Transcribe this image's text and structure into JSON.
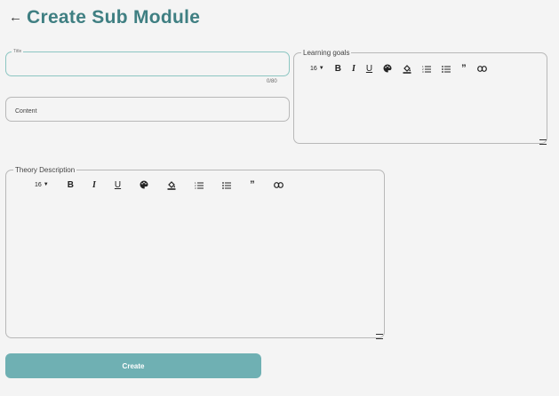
{
  "header": {
    "back_icon": "arrow-left-icon",
    "title": "Create Sub Module"
  },
  "form": {
    "title_field": {
      "label": "Title",
      "value": "",
      "counter": "0/80"
    },
    "content_field": {
      "placeholder": "Content",
      "value": ""
    },
    "learning_goals": {
      "label": "Learning goals",
      "toolbar": {
        "font_size": "16",
        "bold": "B",
        "italic": "I",
        "underline": "U"
      }
    },
    "theory_description": {
      "label": "Theory Description",
      "toolbar": {
        "font_size": "16",
        "bold": "B",
        "italic": "I",
        "underline": "U"
      }
    },
    "create_label": "Create"
  },
  "colors": {
    "accent": "#3f7f82",
    "button": "#6fb0b3",
    "focus_border": "#8cc6c2"
  },
  "icons": [
    "arrow-left-icon",
    "palette-icon",
    "fill-color-icon",
    "ordered-list-icon",
    "bullet-list-icon",
    "quote-icon",
    "link-icon",
    "resize-handle-icon"
  ]
}
